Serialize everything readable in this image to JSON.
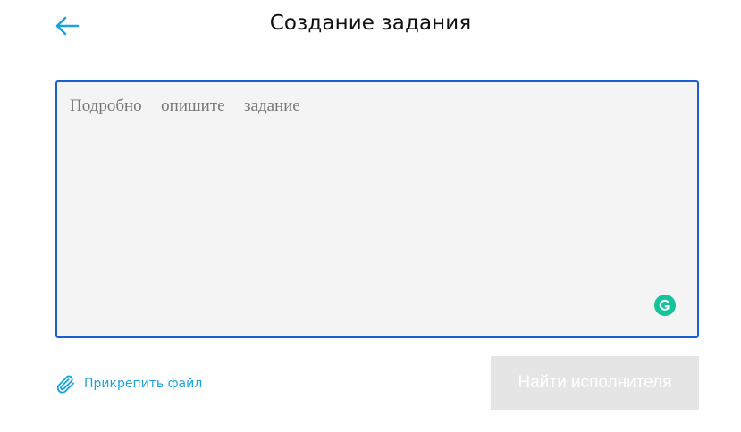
{
  "header": {
    "title": "Создание задания",
    "back_icon": "arrow-left-icon"
  },
  "task": {
    "placeholder": "Подробно  опишите  задание",
    "value": "",
    "grammarly_icon": "grammarly-icon"
  },
  "attach": {
    "label": "Прикрепить файл",
    "icon": "paperclip-icon"
  },
  "submit": {
    "label": "Найти исполнителя"
  },
  "colors": {
    "accent": "#1aa2dc",
    "focus_border": "#1a5fd0",
    "textarea_bg": "#f4f4f4",
    "button_disabled_bg": "#e5e5e5",
    "grammarly": "#15c39a"
  }
}
